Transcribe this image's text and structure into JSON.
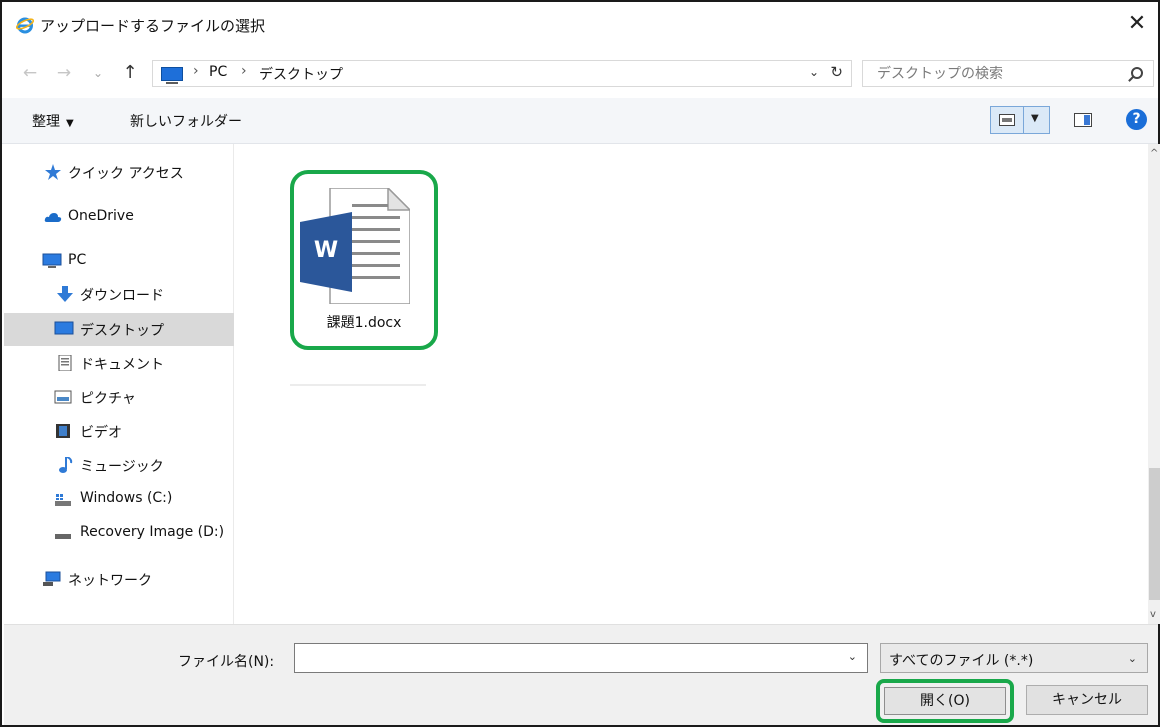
{
  "window": {
    "title": "アップロードするファイルの選択",
    "close_glyph": "✕"
  },
  "nav": {
    "back": "←",
    "forward": "→",
    "recent": "⌄",
    "up": "↑"
  },
  "breadcrumb": {
    "items": [
      "PC",
      "デスクトップ"
    ],
    "separator": "›",
    "dropdown": "⌄",
    "refresh": "↻"
  },
  "search": {
    "placeholder": "デスクトップの検索",
    "value": ""
  },
  "toolbar": {
    "organize_label": "整理",
    "organize_caret": "▼",
    "new_folder_label": "新しいフォルダー",
    "view_caret": "▼",
    "help_label": "?"
  },
  "sidebar": {
    "items": [
      {
        "label": "クイック アクセス",
        "icon": "star-icon",
        "selected": false
      },
      {
        "label": "OneDrive",
        "icon": "cloud-icon",
        "selected": false
      },
      {
        "label": "PC",
        "icon": "computer-icon",
        "selected": false
      },
      {
        "label": "ダウンロード",
        "icon": "download-icon",
        "selected": false
      },
      {
        "label": "デスクトップ",
        "icon": "desktop-icon",
        "selected": true
      },
      {
        "label": "ドキュメント",
        "icon": "document-icon",
        "selected": false
      },
      {
        "label": "ピクチャ",
        "icon": "pictures-icon",
        "selected": false
      },
      {
        "label": "ビデオ",
        "icon": "video-icon",
        "selected": false
      },
      {
        "label": "ミュージック",
        "icon": "music-icon",
        "selected": false
      },
      {
        "label": "Windows (C:)",
        "icon": "drive-windows-icon",
        "selected": false
      },
      {
        "label": "Recovery Image (D:)",
        "icon": "drive-icon",
        "selected": false
      },
      {
        "label": "ネットワーク",
        "icon": "network-icon",
        "selected": false
      }
    ]
  },
  "files": [
    {
      "name": "課題1.docx",
      "icon": "word-doc-icon",
      "badge": "W"
    }
  ],
  "footer": {
    "filename_label": "ファイル名(N):",
    "filename_value": "",
    "filetype_value": "すべてのファイル (*.*)",
    "open_label": "開く(O)",
    "cancel_label": "キャンセル"
  },
  "colors": {
    "highlight": "#19a84a",
    "word_blue": "#2b579a",
    "accent": "#1a6ed8"
  }
}
